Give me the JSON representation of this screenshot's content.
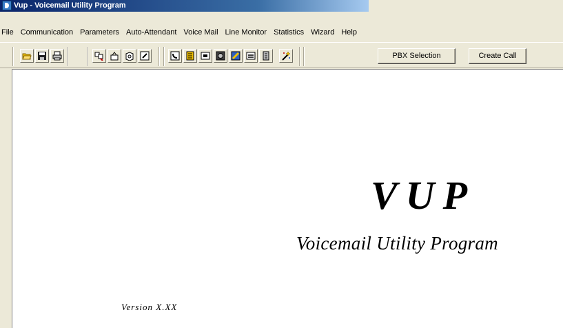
{
  "window": {
    "title": "Vup - Voicemail Utility Program"
  },
  "menu": [
    "File",
    "Communication",
    "Parameters",
    "Auto-Attendant",
    "Voice Mail",
    "Line Monitor",
    "Statistics",
    "Wizard",
    "Help"
  ],
  "toolbar": {
    "icons": [
      "open-folder-icon",
      "save-icon",
      "print-icon",
      "find-icon",
      "open-icon",
      "disk-icon",
      "edit-icon",
      "phone-icon",
      "book-icon",
      "monitor-icon",
      "record-icon",
      "tools-icon",
      "transfer-icon",
      "server-icon",
      "wizard-icon"
    ],
    "pbx_selection_label": "PBX Selection",
    "create_call_label": "Create Call"
  },
  "splash": {
    "logo": "VUP",
    "subtitle": "Voicemail Utility Program",
    "version": "Version X.XX"
  },
  "colors": {
    "titlebar": "#0a246a",
    "face": "#ece9d8",
    "accent_yellow": "#f0c000"
  }
}
